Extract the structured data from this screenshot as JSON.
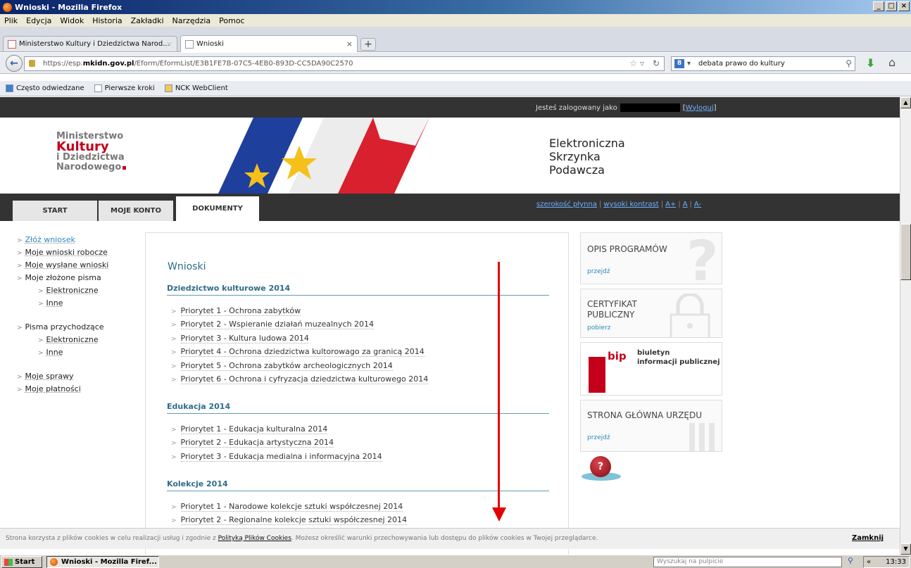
{
  "window": {
    "title": "Wnioski - Mozilla Firefox"
  },
  "menu": [
    "Plik",
    "Edycja",
    "Widok",
    "Historia",
    "Zakładki",
    "Narzędzia",
    "Pomoc"
  ],
  "tabs": [
    {
      "label": "Ministerstwo Kultury i Dziedzictwa Narod..."
    },
    {
      "label": "Wnioski"
    }
  ],
  "nav": {
    "url_prefix": "https://esp.",
    "url_host": "mkidn.gov.pl",
    "url_path": "/Eform/EformList/E3B1FE7B-07C5-4EB0-893D-CC5DA90C2570",
    "search_value": "debata prawo do kultury"
  },
  "bookmarks": [
    "Często odwiedzane",
    "Pierwsze kroki",
    "NCK WebClient"
  ],
  "page": {
    "login_text": "Jesteś zalogowany jako",
    "logout": "Wyloguj",
    "logo": {
      "line1": "Ministerstwo",
      "line2": "Kultury",
      "line3": "i Dziedzictwa",
      "line4": "Narodowego"
    },
    "esp": {
      "line1": "Elektroniczna",
      "line2": "Skrzynka",
      "line3": "Podawcza"
    },
    "nav_tabs": [
      "START",
      "MOJE KONTO",
      "DOKUMENTY"
    ],
    "access": {
      "fluid": "szerokość płynna",
      "contrast": "wysoki kontrast",
      "a_plus": "A+",
      "a": "A",
      "a_minus": "A-"
    },
    "left_nav": [
      "Złóż wniosek",
      "Moje wnioski robocze",
      "Moje wysłane wnioski",
      "Moje złożone pisma",
      "Elektroniczne",
      "Inne",
      "Pisma przychodzące",
      "Elektroniczne",
      "Inne",
      "Moje sprawy",
      "Moje płatności"
    ],
    "content": {
      "title": "Wnioski",
      "sections": [
        {
          "name": "Dziedzictwo kulturowe 2014",
          "items": [
            "Priorytet 1 - Ochrona zabytków",
            "Priorytet 2 - Wspieranie działań muzealnych 2014",
            "Priorytet 3 - Kultura ludowa 2014",
            "Priorytet 4 - Ochrona dziedzictwa kultorowago za granicą 2014",
            "Priorytet 5 - Ochrona zabytków archeologicznych 2014",
            "Priorytet 6 - Ochrona i cyfryzacja dziedzictwa kulturowego 2014"
          ]
        },
        {
          "name": "Edukacja 2014",
          "items": [
            "Priorytet 1 - Edukacja kulturalna 2014",
            "Priorytet 2 - Edukacja artystyczna 2014",
            "Priorytet 3 - Edukacja medialna i informacyjna 2014"
          ]
        },
        {
          "name": "Kolekcje 2014",
          "items": [
            "Priorytet 1 - Narodowe kolekcje sztuki współczesnej 2014",
            "Priorytet 2 - Regionalne kolekcje sztuki współczesnej 2014"
          ]
        }
      ]
    },
    "right": {
      "opis": {
        "title": "OPIS PROGRAMÓW",
        "link": "przejdź"
      },
      "cert": {
        "line1": "CERTYFIKAT",
        "line2": "PUBLICZNY",
        "link": "pobierz"
      },
      "bip": {
        "mark": "bip",
        "line1": "biuletyn",
        "line2": "informacji publicznej"
      },
      "strona": {
        "title": "STRONA GŁÓWNA URZĘDU",
        "link": "przejdź"
      }
    },
    "cookie": {
      "before": "Strona korzysta z plików cookies w celu realizacji usług i zgodnie z ",
      "policy": "Polityką Plików Cookies",
      "after": ". Możesz określić warunki przechowywania lub dostępu do plików cookies w Twojej przeglądarce.",
      "close": "Zamknij"
    }
  },
  "taskbar": {
    "start": "Start",
    "item": "Wnioski - Mozilla Firef...",
    "search_placeholder": "Wyszukaj na pulpicie",
    "tray_prefix": "«",
    "clock": "13:33"
  },
  "colors": {
    "accent_blue": "#2e6c8a",
    "mkidn_red": "#c4001a",
    "annotation_arrow": "#e30000"
  }
}
